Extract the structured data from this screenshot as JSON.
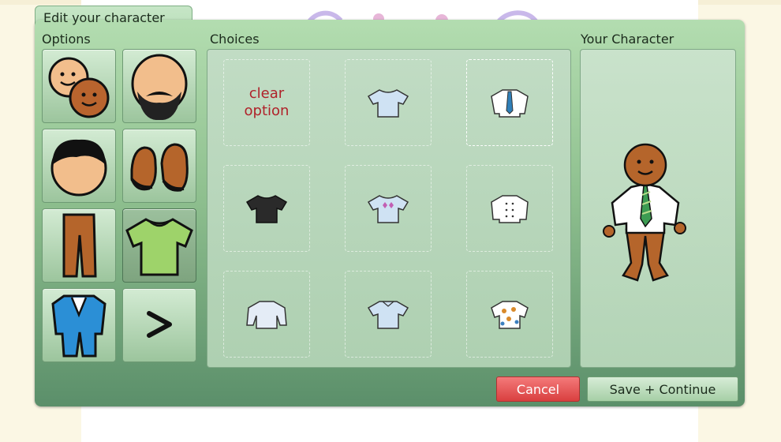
{
  "dialog": {
    "title": "Edit your character",
    "options_label": "Options",
    "choices_label": "Choices",
    "preview_label": "Your Character"
  },
  "options": [
    {
      "icon": "skin-tone-icon"
    },
    {
      "icon": "facial-hair-icon"
    },
    {
      "icon": "hair-icon"
    },
    {
      "icon": "shoes-icon"
    },
    {
      "icon": "pants-icon"
    },
    {
      "icon": "shirt-icon",
      "selected": true
    },
    {
      "icon": "suit-icon"
    },
    {
      "icon": "next-arrow-icon",
      "label": ">"
    }
  ],
  "choices": {
    "clear_line1": "clear",
    "clear_line2": "option",
    "items": [
      "light-blue-tshirt-icon",
      "white-shirt-tie-icon",
      "black-tshirt-icon",
      "argyle-tshirt-icon",
      "chef-jacket-icon",
      "white-longsleeve-icon",
      "blue-tshirt-icon",
      "hawaiian-shirt-icon"
    ]
  },
  "buttons": {
    "cancel": "Cancel",
    "save": "Save + Continue"
  },
  "colors": {
    "panel_green": "#8fc08f",
    "cancel_red": "#d93f3f",
    "clear_text": "#b0222a"
  }
}
